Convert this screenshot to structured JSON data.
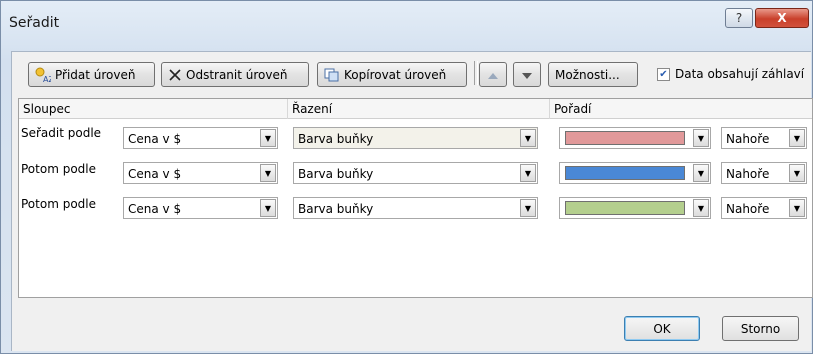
{
  "window": {
    "title": "Seřadit",
    "help_label": "?",
    "close_label": "X"
  },
  "toolbar": {
    "add_level": "Přidat úroveň",
    "delete_level": "Odstranit úroveň",
    "copy_level": "Kopírovat úroveň",
    "options": "Možnosti...",
    "header_checkbox_label": "Data obsahují záhlaví",
    "header_checkbox_checked": true
  },
  "grid": {
    "headers": {
      "column": "Sloupec",
      "sort_on": "Řazení",
      "order": "Pořadí"
    },
    "rows": [
      {
        "label": "Seřadit podle",
        "column": "Cena v $",
        "sort_on": "Barva buňky",
        "color": "#e1999a",
        "position": "Nahoře"
      },
      {
        "label": "Potom podle",
        "column": "Cena v $",
        "sort_on": "Barva buňky",
        "color": "#4a88d6",
        "position": "Nahoře"
      },
      {
        "label": "Potom podle",
        "column": "Cena v $",
        "sort_on": "Barva buňky",
        "color": "#b4cf8e",
        "position": "Nahoře"
      }
    ]
  },
  "buttons": {
    "ok": "OK",
    "cancel": "Storno"
  }
}
